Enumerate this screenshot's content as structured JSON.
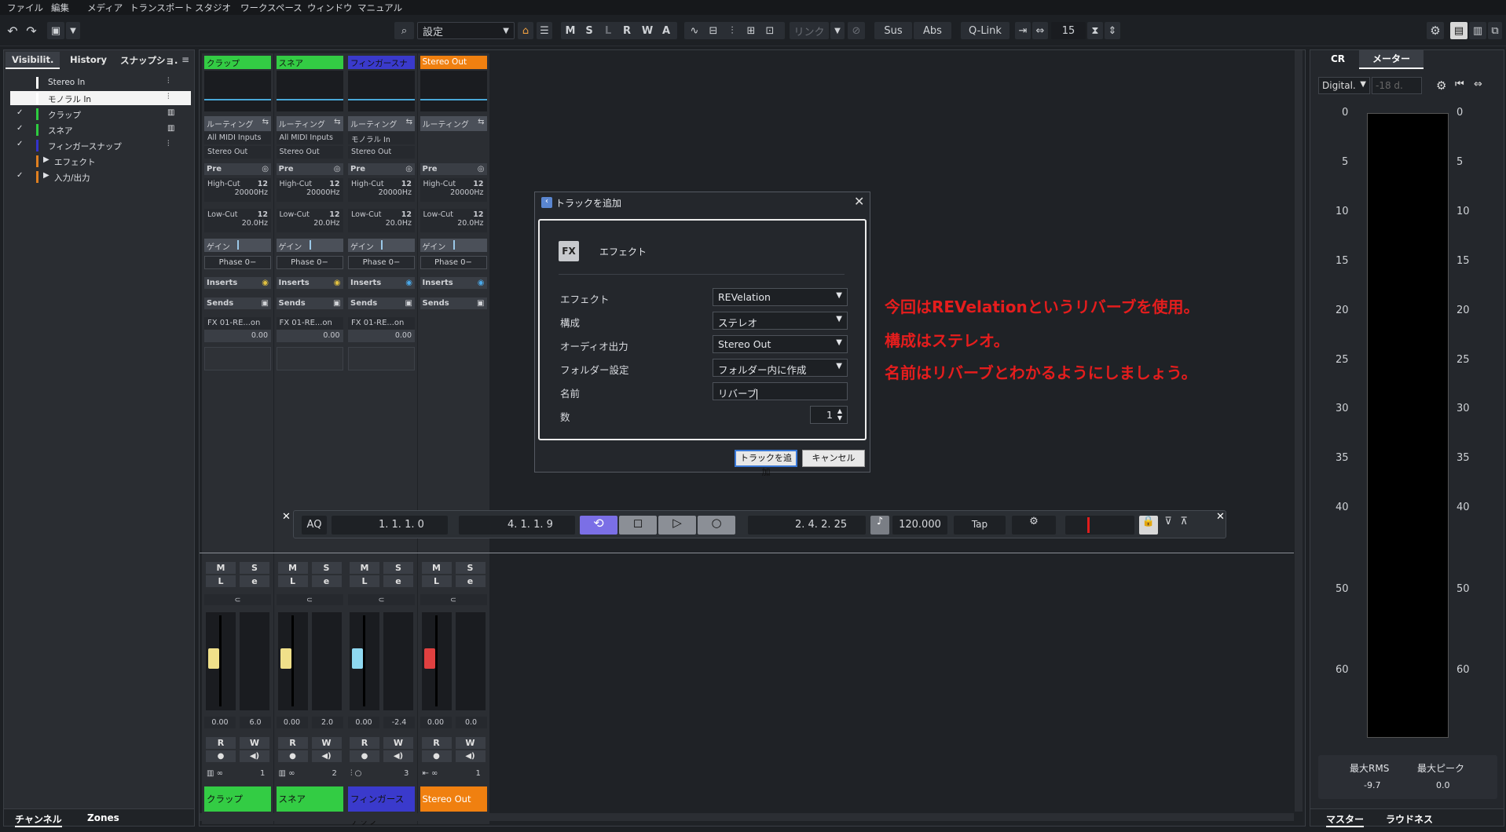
{
  "menu": [
    "ファイル",
    "編集",
    "メディア",
    "トランスポート",
    "スタジオ",
    "ワークスペース",
    "ウィンドウ",
    "マニュアル"
  ],
  "toolbar": {
    "settings_value": "設定",
    "mode_buttons": [
      "M",
      "S",
      "L",
      "R",
      "W",
      "A"
    ],
    "link_label": "リンク",
    "sus": "Sus",
    "abs": "Abs",
    "qlink": "Q-Link",
    "channels": "15"
  },
  "left_panel": {
    "tabs": [
      "Visibilit.",
      "History",
      "スナップショ."
    ],
    "tracks": [
      {
        "label": "Stereo In",
        "color": "#ffffff",
        "checked": false
      },
      {
        "label": "モノラル In",
        "color": "#ffffff",
        "checked": false,
        "selected": true
      },
      {
        "label": "クラップ",
        "color": "#2ecc40",
        "checked": true
      },
      {
        "label": "スネア",
        "color": "#2ecc40",
        "checked": true
      },
      {
        "label": "フィンガースナップ",
        "color": "#3333cc",
        "checked": true
      },
      {
        "label": "エフェクト",
        "color": "#e08020",
        "checked": false,
        "folder": true
      },
      {
        "label": "入力/出力",
        "color": "#e08020",
        "checked": true,
        "folder": true
      }
    ],
    "bottom_tabs": [
      "チャンネル",
      "Zones"
    ]
  },
  "channels": [
    {
      "name": "クラップ",
      "color": "#33cc44",
      "routing": "ルーティング",
      "input": "All MIDI Inputs",
      "output": "Stereo Out",
      "pre": "Pre",
      "highcut_label": "High-Cut",
      "highcut": "20000Hz",
      "lowcut_label": "Low-Cut",
      "lowcut": "20.0Hz",
      "gain": "ゲイン",
      "phase": "Phase 0−",
      "inserts": "Inserts",
      "sends": "Sends",
      "send_name": "FX 01-RE...on",
      "send_value": "0.00",
      "fader_value": "0.00",
      "pan_value": "6.0",
      "number": "1",
      "fader_color": "#f0e08a",
      "fader_level": 0.62
    },
    {
      "name": "スネア",
      "color": "#33cc44",
      "routing": "ルーティング",
      "input": "All MIDI Inputs",
      "output": "Stereo Out",
      "pre": "Pre",
      "highcut_label": "High-Cut",
      "highcut": "20000Hz",
      "lowcut_label": "Low-Cut",
      "lowcut": "20.0Hz",
      "gain": "ゲイン",
      "phase": "Phase 0−",
      "inserts": "Inserts",
      "sends": "Sends",
      "send_name": "FX 01-RE...on",
      "send_value": "0.00",
      "fader_value": "0.00",
      "pan_value": "2.0",
      "number": "2",
      "fader_color": "#f0e08a",
      "fader_level": 0.62
    },
    {
      "name": "フィンガースナップ",
      "color": "#3a3acc",
      "routing": "ルーティング",
      "input": "モノラル In",
      "output": "Stereo Out",
      "pre": "Pre",
      "highcut_label": "High-Cut",
      "highcut": "20000Hz",
      "lowcut_label": "Low-Cut",
      "lowcut": "20.0Hz",
      "gain": "ゲイン",
      "phase": "Phase 0−",
      "inserts": "Inserts",
      "sends": "Sends",
      "send_name": "FX 01-RE...on",
      "send_value": "0.00",
      "fader_value": "0.00",
      "pan_value": "-2.4",
      "number": "3",
      "fader_color": "#8fd8f0",
      "fader_level": 0.62
    },
    {
      "name": "Stereo Out",
      "color": "#f08010",
      "routing": "ルーティング",
      "input": "",
      "output": "",
      "pre": "Pre",
      "highcut_label": "High-Cut",
      "highcut": "20000Hz",
      "lowcut_label": "Low-Cut",
      "lowcut": "20.0Hz",
      "gain": "ゲイン",
      "phase": "Phase 0−",
      "inserts": "Inserts",
      "sends": "Sends",
      "send_name": "",
      "send_value": "",
      "fader_value": "0.00",
      "pan_value": "0.0",
      "number": "1",
      "fader_color": "#e04040",
      "fader_level": 0.62
    }
  ],
  "dialog": {
    "title": "トラックを追加",
    "type_icon": "FX",
    "type_label": "エフェクト",
    "fields": [
      {
        "label": "エフェクト",
        "value": "REVelation"
      },
      {
        "label": "構成",
        "value": "ステレオ"
      },
      {
        "label": "オーディオ出力",
        "value": "Stereo Out"
      },
      {
        "label": "フォルダー設定",
        "value": "フォルダー内に作成"
      }
    ],
    "name_label": "名前",
    "name_value": "リバーブ",
    "count_label": "数",
    "count_value": "1",
    "add_button": "トラックを追加",
    "cancel_button": "キャンセル"
  },
  "annotations": [
    "今回はREVelationというリバーブを使用。",
    "構成はステレオ。",
    "名前はリバーブとわかるようにしましょう。"
  ],
  "transport": {
    "aq": "AQ",
    "left_locator": "1. 1. 1.   0",
    "right_locator": "4. 1. 1.   9",
    "position": "2. 4. 2. 25",
    "tempo": "120.000",
    "tap": "Tap"
  },
  "right_panel": {
    "tabs": [
      "CR",
      "メーター"
    ],
    "meter_type": "Digital.",
    "reference": "-18 d.",
    "scale": [
      "0",
      "5",
      "10",
      "15",
      "20",
      "25",
      "30",
      "35",
      "40",
      "50",
      "60"
    ],
    "max_rms_label": "最大RMS",
    "max_rms": "-9.7",
    "max_peak_label": "最大ピーク",
    "max_peak": "0.0",
    "bottom_tabs": [
      "マスター",
      "ラウドネス"
    ]
  }
}
